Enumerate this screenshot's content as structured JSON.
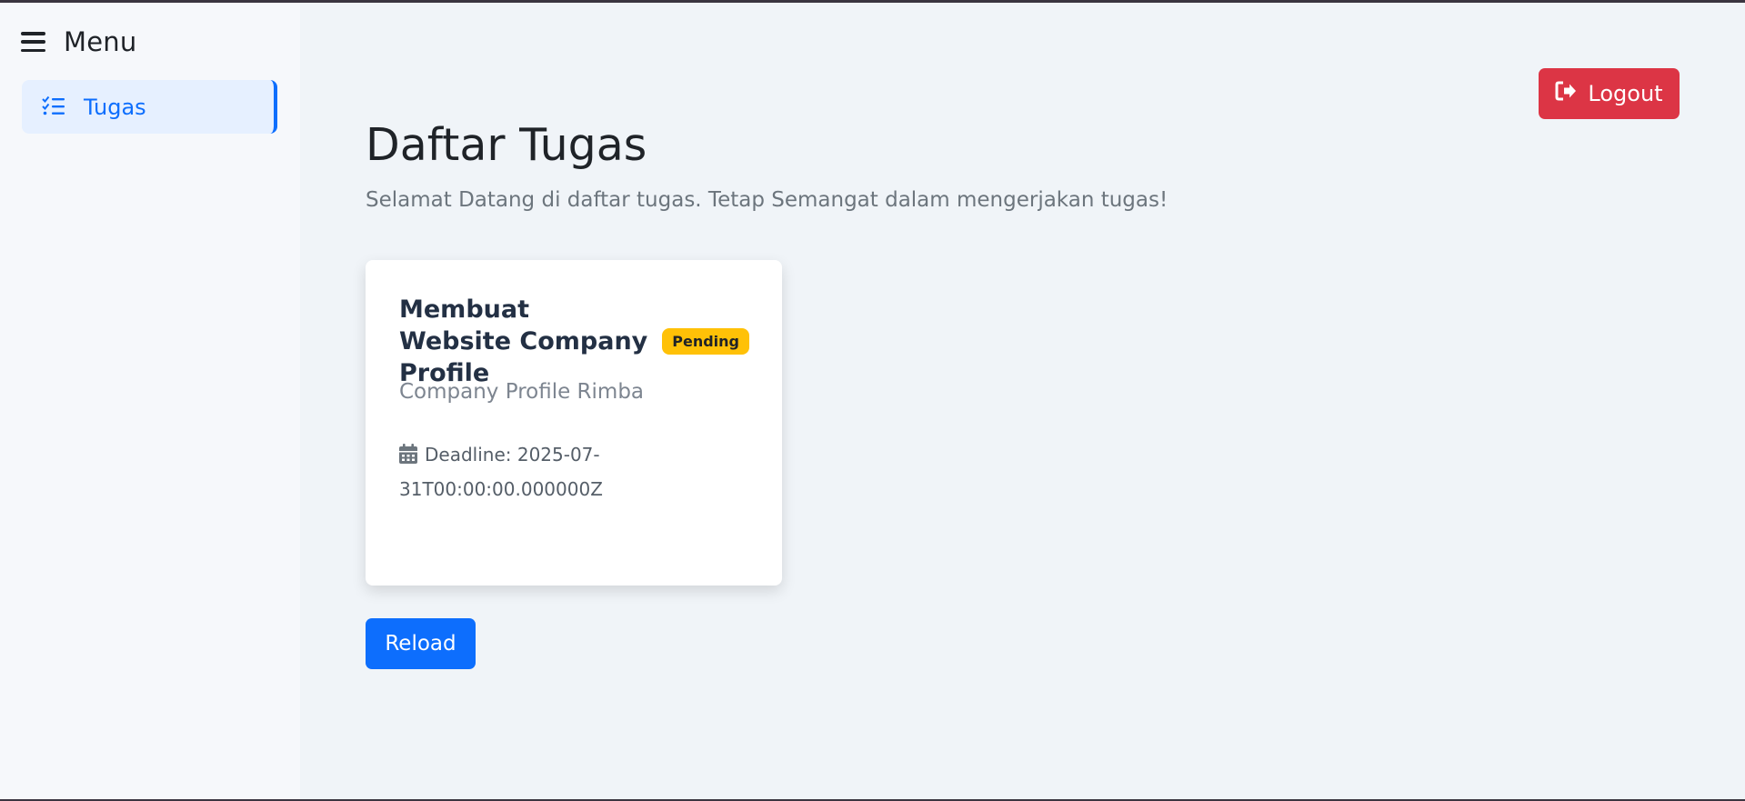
{
  "sidebar": {
    "menu_title": "Menu",
    "items": [
      {
        "label": "Tugas",
        "icon": "list-check-icon",
        "active": true
      }
    ]
  },
  "header": {
    "logout_label": "Logout"
  },
  "main": {
    "title": "Daftar Tugas",
    "subtitle": "Selamat Datang di daftar tugas. Tetap Semangat dalam mengerjakan tugas!",
    "tasks": [
      {
        "title": "Membuat Website Company Profile",
        "status": "Pending",
        "description": "Company Profile Rimba",
        "deadline": "Deadline: 2025-07-31T00:00:00.000000Z"
      }
    ],
    "reload_label": "Reload"
  },
  "colors": {
    "primary": "#0d6efd",
    "danger": "#dc3545",
    "warning": "#ffc107",
    "background": "#f0f4f8",
    "sidebar_bg": "#f6f8fb"
  }
}
